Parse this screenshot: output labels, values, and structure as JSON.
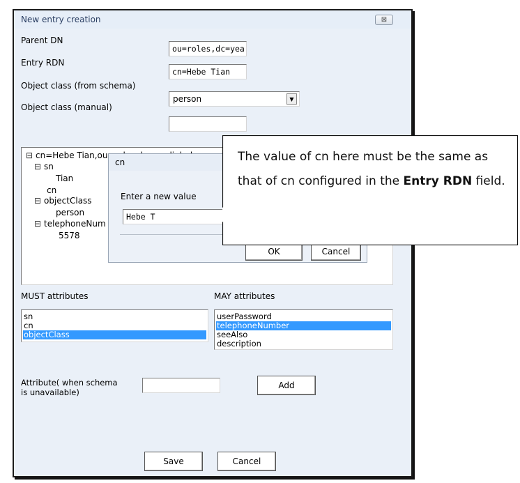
{
  "window": {
    "title": "New entry creation",
    "close_glyph": "⊠"
  },
  "form": {
    "parent_dn_label": "Parent DN",
    "parent_dn_value": "ou=roles,dc=yea",
    "entry_rdn_label": "Entry RDN",
    "entry_rdn_value": "cn=Hebe Tian",
    "object_class_schema_label": "Object class (from schema)",
    "object_class_schema_value": "person",
    "object_class_manual_label": "Object class (manual)",
    "object_class_manual_value": ""
  },
  "tree": {
    "root": "cn=Hebe Tian,ou=roles,dc=yealink,dc=c",
    "sn": "sn",
    "sn_value": "Tian",
    "cn": "cn",
    "objectclass": "objectClass",
    "objectclass_value": "person",
    "telephone": "telephoneNum",
    "telephone_value": "5578"
  },
  "dialog": {
    "title": "cn",
    "prompt": "Enter a new value",
    "value": "Hebe T",
    "ok_label": "OK",
    "cancel_label": "Cancel"
  },
  "callout": {
    "text_before": "The value of cn here must be the same as that of cn configured in the ",
    "bold_term": "Entry RDN",
    "text_after": " field."
  },
  "must": {
    "label": "MUST attributes",
    "items": [
      "sn",
      "cn",
      "objectClass"
    ],
    "selected": "objectClass"
  },
  "may": {
    "label": "MAY attributes",
    "items": [
      "userPassword",
      "telephoneNumber",
      "seeAlso",
      "description"
    ],
    "selected": "telephoneNumber"
  },
  "attribute": {
    "label_line1": "Attribute( when schema",
    "label_line2": "is unavailable)",
    "value": "",
    "add_label": "Add"
  },
  "footer": {
    "save_label": "Save",
    "cancel_label": "Cancel"
  },
  "colors": {
    "selection": "#3399ff",
    "window_bg": "#eaf0f8"
  }
}
